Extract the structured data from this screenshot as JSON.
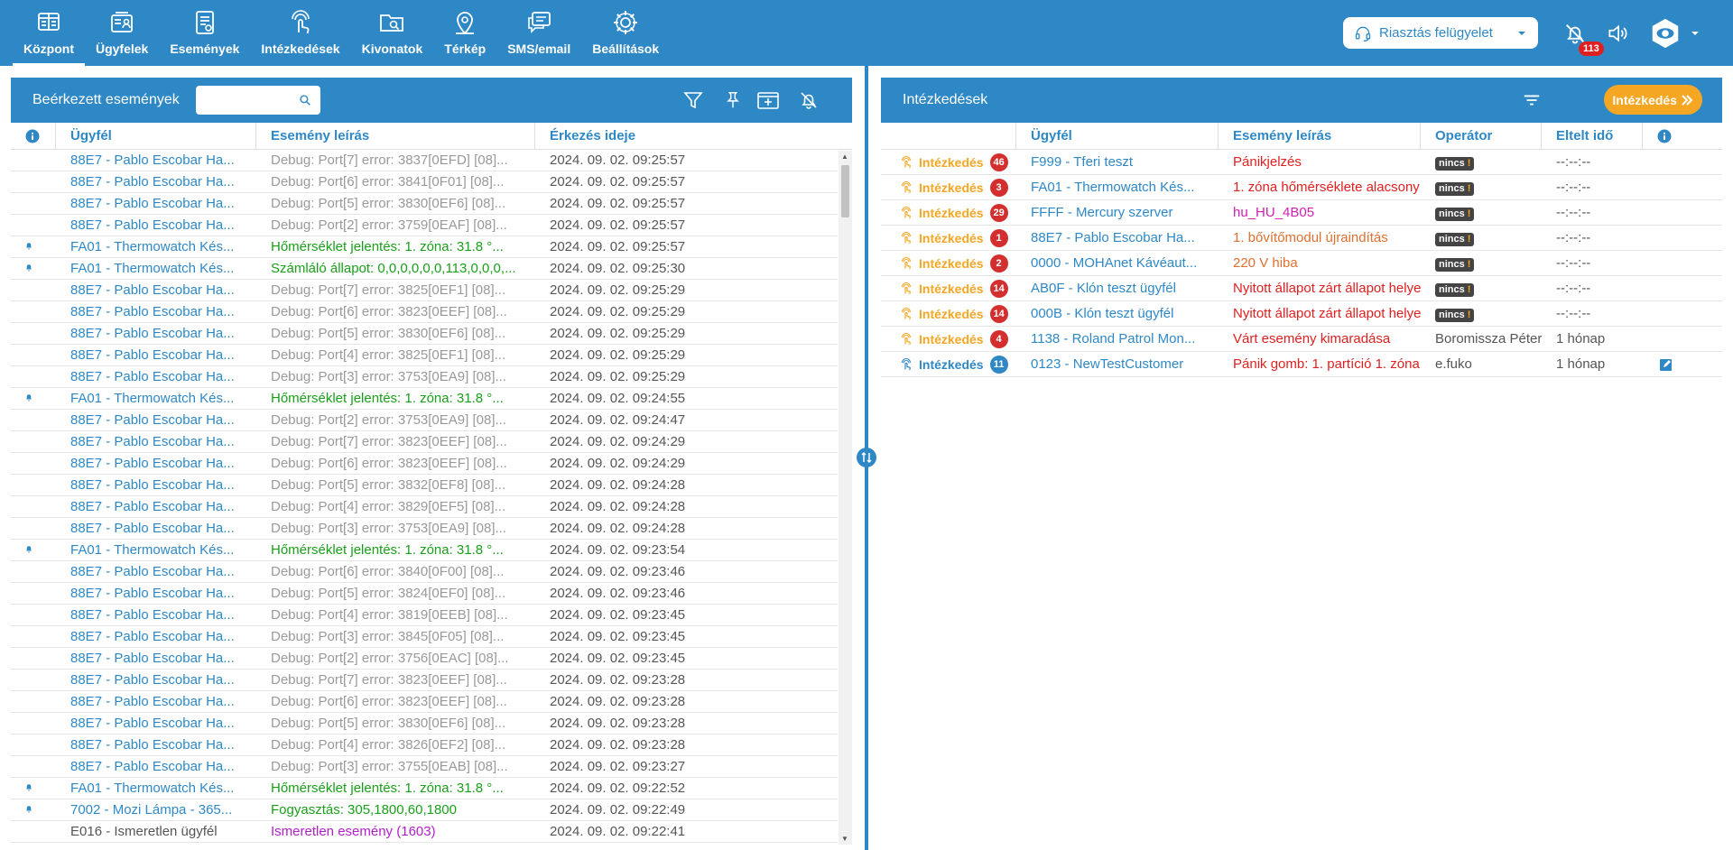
{
  "nav": [
    {
      "label": "Központ",
      "icon": "dashboard-icon",
      "active": true
    },
    {
      "label": "Ügyfelek",
      "icon": "clients-icon"
    },
    {
      "label": "Események",
      "icon": "events-icon"
    },
    {
      "label": "Intézkedések",
      "icon": "touch-icon"
    },
    {
      "label": "Kivonatok",
      "icon": "folder-search-icon"
    },
    {
      "label": "Térkép",
      "icon": "map-pin-icon"
    },
    {
      "label": "SMS/email",
      "icon": "chat-icon"
    },
    {
      "label": "Beállítások",
      "icon": "gear-icon"
    }
  ],
  "header": {
    "alarm_select": "Riasztás felügyelet",
    "alarm_count": "113"
  },
  "events_panel": {
    "title": "Beérkezett események",
    "search_placeholder": "",
    "columns": {
      "client": "Ügyfél",
      "desc": "Esemény leírás",
      "time": "Érkezés ideje"
    },
    "rows": [
      {
        "bell": false,
        "client": "88E7 - Pablo Escobar Ha...",
        "desc": "Debug: Port[7] error: 3837[0EFD] [08]...",
        "time": "2024. 09. 02. 09:25:57",
        "client_color": "blue",
        "desc_color": "grey"
      },
      {
        "bell": false,
        "client": "88E7 - Pablo Escobar Ha...",
        "desc": "Debug: Port[6] error: 3841[0F01] [08]...",
        "time": "2024. 09. 02. 09:25:57",
        "client_color": "blue",
        "desc_color": "grey"
      },
      {
        "bell": false,
        "client": "88E7 - Pablo Escobar Ha...",
        "desc": "Debug: Port[5] error: 3830[0EF6] [08]...",
        "time": "2024. 09. 02. 09:25:57",
        "client_color": "blue",
        "desc_color": "grey"
      },
      {
        "bell": false,
        "client": "88E7 - Pablo Escobar Ha...",
        "desc": "Debug: Port[2] error: 3759[0EAF] [08]...",
        "time": "2024. 09. 02. 09:25:57",
        "client_color": "blue",
        "desc_color": "grey"
      },
      {
        "bell": true,
        "client": "FA01 - Thermowatch Kés...",
        "desc": "Hőmérséklet jelentés: 1. zóna: 31.8 °...",
        "time": "2024. 09. 02. 09:25:57",
        "client_color": "blue",
        "desc_color": "green"
      },
      {
        "bell": true,
        "client": "FA01 - Thermowatch Kés...",
        "desc": "Számláló állapot: 0,0,0,0,0,0,113,0,0,0,...",
        "time": "2024. 09. 02. 09:25:30",
        "client_color": "blue",
        "desc_color": "green"
      },
      {
        "bell": false,
        "client": "88E7 - Pablo Escobar Ha...",
        "desc": "Debug: Port[7] error: 3825[0EF1] [08]...",
        "time": "2024. 09. 02. 09:25:29",
        "client_color": "blue",
        "desc_color": "grey"
      },
      {
        "bell": false,
        "client": "88E7 - Pablo Escobar Ha...",
        "desc": "Debug: Port[6] error: 3823[0EEF] [08]...",
        "time": "2024. 09. 02. 09:25:29",
        "client_color": "blue",
        "desc_color": "grey"
      },
      {
        "bell": false,
        "client": "88E7 - Pablo Escobar Ha...",
        "desc": "Debug: Port[5] error: 3830[0EF6] [08]...",
        "time": "2024. 09. 02. 09:25:29",
        "client_color": "blue",
        "desc_color": "grey"
      },
      {
        "bell": false,
        "client": "88E7 - Pablo Escobar Ha...",
        "desc": "Debug: Port[4] error: 3825[0EF1] [08]...",
        "time": "2024. 09. 02. 09:25:29",
        "client_color": "blue",
        "desc_color": "grey"
      },
      {
        "bell": false,
        "client": "88E7 - Pablo Escobar Ha...",
        "desc": "Debug: Port[3] error: 3753[0EA9] [08]...",
        "time": "2024. 09. 02. 09:25:29",
        "client_color": "blue",
        "desc_color": "grey"
      },
      {
        "bell": true,
        "client": "FA01 - Thermowatch Kés...",
        "desc": "Hőmérséklet jelentés: 1. zóna: 31.8 °...",
        "time": "2024. 09. 02. 09:24:55",
        "client_color": "blue",
        "desc_color": "green"
      },
      {
        "bell": false,
        "client": "88E7 - Pablo Escobar Ha...",
        "desc": "Debug: Port[2] error: 3753[0EA9] [08]...",
        "time": "2024. 09. 02. 09:24:47",
        "client_color": "blue",
        "desc_color": "grey"
      },
      {
        "bell": false,
        "client": "88E7 - Pablo Escobar Ha...",
        "desc": "Debug: Port[7] error: 3823[0EEF] [08]...",
        "time": "2024. 09. 02. 09:24:29",
        "client_color": "blue",
        "desc_color": "grey"
      },
      {
        "bell": false,
        "client": "88E7 - Pablo Escobar Ha...",
        "desc": "Debug: Port[6] error: 3823[0EEF] [08]...",
        "time": "2024. 09. 02. 09:24:29",
        "client_color": "blue",
        "desc_color": "grey"
      },
      {
        "bell": false,
        "client": "88E7 - Pablo Escobar Ha...",
        "desc": "Debug: Port[5] error: 3832[0EF8] [08]...",
        "time": "2024. 09. 02. 09:24:28",
        "client_color": "blue",
        "desc_color": "grey"
      },
      {
        "bell": false,
        "client": "88E7 - Pablo Escobar Ha...",
        "desc": "Debug: Port[4] error: 3829[0EF5] [08]...",
        "time": "2024. 09. 02. 09:24:28",
        "client_color": "blue",
        "desc_color": "grey"
      },
      {
        "bell": false,
        "client": "88E7 - Pablo Escobar Ha...",
        "desc": "Debug: Port[3] error: 3753[0EA9] [08]...",
        "time": "2024. 09. 02. 09:24:28",
        "client_color": "blue",
        "desc_color": "grey"
      },
      {
        "bell": true,
        "client": "FA01 - Thermowatch Kés...",
        "desc": "Hőmérséklet jelentés: 1. zóna: 31.8 °...",
        "time": "2024. 09. 02. 09:23:54",
        "client_color": "blue",
        "desc_color": "green"
      },
      {
        "bell": false,
        "client": "88E7 - Pablo Escobar Ha...",
        "desc": "Debug: Port[6] error: 3840[0F00] [08]...",
        "time": "2024. 09. 02. 09:23:46",
        "client_color": "blue",
        "desc_color": "grey"
      },
      {
        "bell": false,
        "client": "88E7 - Pablo Escobar Ha...",
        "desc": "Debug: Port[5] error: 3824[0EF0] [08]...",
        "time": "2024. 09. 02. 09:23:46",
        "client_color": "blue",
        "desc_color": "grey"
      },
      {
        "bell": false,
        "client": "88E7 - Pablo Escobar Ha...",
        "desc": "Debug: Port[4] error: 3819[0EEB] [08]...",
        "time": "2024. 09. 02. 09:23:45",
        "client_color": "blue",
        "desc_color": "grey"
      },
      {
        "bell": false,
        "client": "88E7 - Pablo Escobar Ha...",
        "desc": "Debug: Port[3] error: 3845[0F05] [08]...",
        "time": "2024. 09. 02. 09:23:45",
        "client_color": "blue",
        "desc_color": "grey"
      },
      {
        "bell": false,
        "client": "88E7 - Pablo Escobar Ha...",
        "desc": "Debug: Port[2] error: 3756[0EAC] [08]...",
        "time": "2024. 09. 02. 09:23:45",
        "client_color": "blue",
        "desc_color": "grey"
      },
      {
        "bell": false,
        "client": "88E7 - Pablo Escobar Ha...",
        "desc": "Debug: Port[7] error: 3823[0EEF] [08]...",
        "time": "2024. 09. 02. 09:23:28",
        "client_color": "blue",
        "desc_color": "grey"
      },
      {
        "bell": false,
        "client": "88E7 - Pablo Escobar Ha...",
        "desc": "Debug: Port[6] error: 3823[0EEF] [08]...",
        "time": "2024. 09. 02. 09:23:28",
        "client_color": "blue",
        "desc_color": "grey"
      },
      {
        "bell": false,
        "client": "88E7 - Pablo Escobar Ha...",
        "desc": "Debug: Port[5] error: 3830[0EF6] [08]...",
        "time": "2024. 09. 02. 09:23:28",
        "client_color": "blue",
        "desc_color": "grey"
      },
      {
        "bell": false,
        "client": "88E7 - Pablo Escobar Ha...",
        "desc": "Debug: Port[4] error: 3826[0EF2] [08]...",
        "time": "2024. 09. 02. 09:23:28",
        "client_color": "blue",
        "desc_color": "grey"
      },
      {
        "bell": false,
        "client": "88E7 - Pablo Escobar Ha...",
        "desc": "Debug: Port[3] error: 3755[0EAB] [08]...",
        "time": "2024. 09. 02. 09:23:27",
        "client_color": "blue",
        "desc_color": "grey"
      },
      {
        "bell": true,
        "client": "FA01 - Thermowatch Kés...",
        "desc": "Hőmérséklet jelentés: 1. zóna: 31.8 °...",
        "time": "2024. 09. 02. 09:22:52",
        "client_color": "blue",
        "desc_color": "green"
      },
      {
        "bell": true,
        "client": "7002 - Mozi Lámpa - 365...",
        "desc": "Fogyasztás: 305,1800,60,1800",
        "time": "2024. 09. 02. 09:22:49",
        "client_color": "blue",
        "desc_color": "green"
      },
      {
        "bell": false,
        "client": "E016 - Ismeretlen ügyfél",
        "desc": "Ismeretlen esemény (1603)",
        "time": "2024. 09. 02. 09:22:41",
        "client_color": "darkgrey",
        "desc_color": "purple"
      }
    ]
  },
  "actions_panel": {
    "title": "Intézkedések",
    "button": "Intézkedés",
    "columns": {
      "client": "Ügyfél",
      "desc": "Esemény leírás",
      "operator": "Operátor",
      "elapsed": "Eltelt idő"
    },
    "rows": [
      {
        "label": "Intézkedés",
        "label_color": "orange",
        "count": "46",
        "count_color": "red",
        "client": "F999 - Tferi teszt",
        "desc": "Pánikjelzés",
        "desc_color": "red",
        "operator": "nincs",
        "operator_badge": true,
        "elapsed": "--:--:--",
        "edit": false
      },
      {
        "label": "Intézkedés",
        "label_color": "orange",
        "count": "3",
        "count_color": "red",
        "client": "FA01 - Thermowatch Kés...",
        "desc": "1. zóna hőmérséklete alacsony",
        "desc_color": "red",
        "operator": "nincs",
        "operator_badge": true,
        "elapsed": "--:--:--",
        "edit": false
      },
      {
        "label": "Intézkedés",
        "label_color": "orange",
        "count": "29",
        "count_color": "red",
        "client": "FFFF - Mercury szerver",
        "desc": "hu_HU_4B05",
        "desc_color": "magenta",
        "operator": "nincs",
        "operator_badge": true,
        "elapsed": "--:--:--",
        "edit": false
      },
      {
        "label": "Intézkedés",
        "label_color": "orange",
        "count": "1",
        "count_color": "red",
        "client": "88E7 - Pablo Escobar Ha...",
        "desc": "1. bővítőmodul újraindítás",
        "desc_color": "orange",
        "operator": "nincs",
        "operator_badge": true,
        "elapsed": "--:--:--",
        "edit": false
      },
      {
        "label": "Intézkedés",
        "label_color": "orange",
        "count": "2",
        "count_color": "red",
        "client": "0000 - MOHAnet Kávéaut...",
        "desc": "220 V hiba",
        "desc_color": "orange",
        "operator": "nincs",
        "operator_badge": true,
        "elapsed": "--:--:--",
        "edit": false
      },
      {
        "label": "Intézkedés",
        "label_color": "orange",
        "count": "14",
        "count_color": "red",
        "client": "AB0F - Klón teszt ügyfél",
        "desc": "Nyitott állapot zárt állapot helyett",
        "desc_color": "red",
        "operator": "nincs",
        "operator_badge": true,
        "elapsed": "--:--:--",
        "edit": false
      },
      {
        "label": "Intézkedés",
        "label_color": "orange",
        "count": "14",
        "count_color": "red",
        "client": "000B - Klón teszt ügyfél",
        "desc": "Nyitott állapot zárt állapot helyett",
        "desc_color": "red",
        "operator": "nincs",
        "operator_badge": true,
        "elapsed": "--:--:--",
        "edit": false
      },
      {
        "label": "Intézkedés",
        "label_color": "orange",
        "count": "4",
        "count_color": "red",
        "client": "1138 - Roland Patrol Mon...",
        "desc": "Várt esemény kimaradása",
        "desc_color": "red",
        "operator": "Boromissza Péter",
        "operator_badge": false,
        "elapsed": "1 hónap",
        "edit": false
      },
      {
        "label": "Intézkedés",
        "label_color": "blue",
        "count": "11",
        "count_color": "blue",
        "client": "0123 - NewTestCustomer",
        "desc": "Pánik gomb: 1. partíció 1. zóna",
        "desc_color": "red",
        "operator": "e.fuko",
        "operator_badge": false,
        "elapsed": "1 hónap",
        "edit": true
      }
    ]
  },
  "colors": {
    "primary": "#2f88c6",
    "accent": "#f5a623",
    "alert": "#e02020"
  }
}
